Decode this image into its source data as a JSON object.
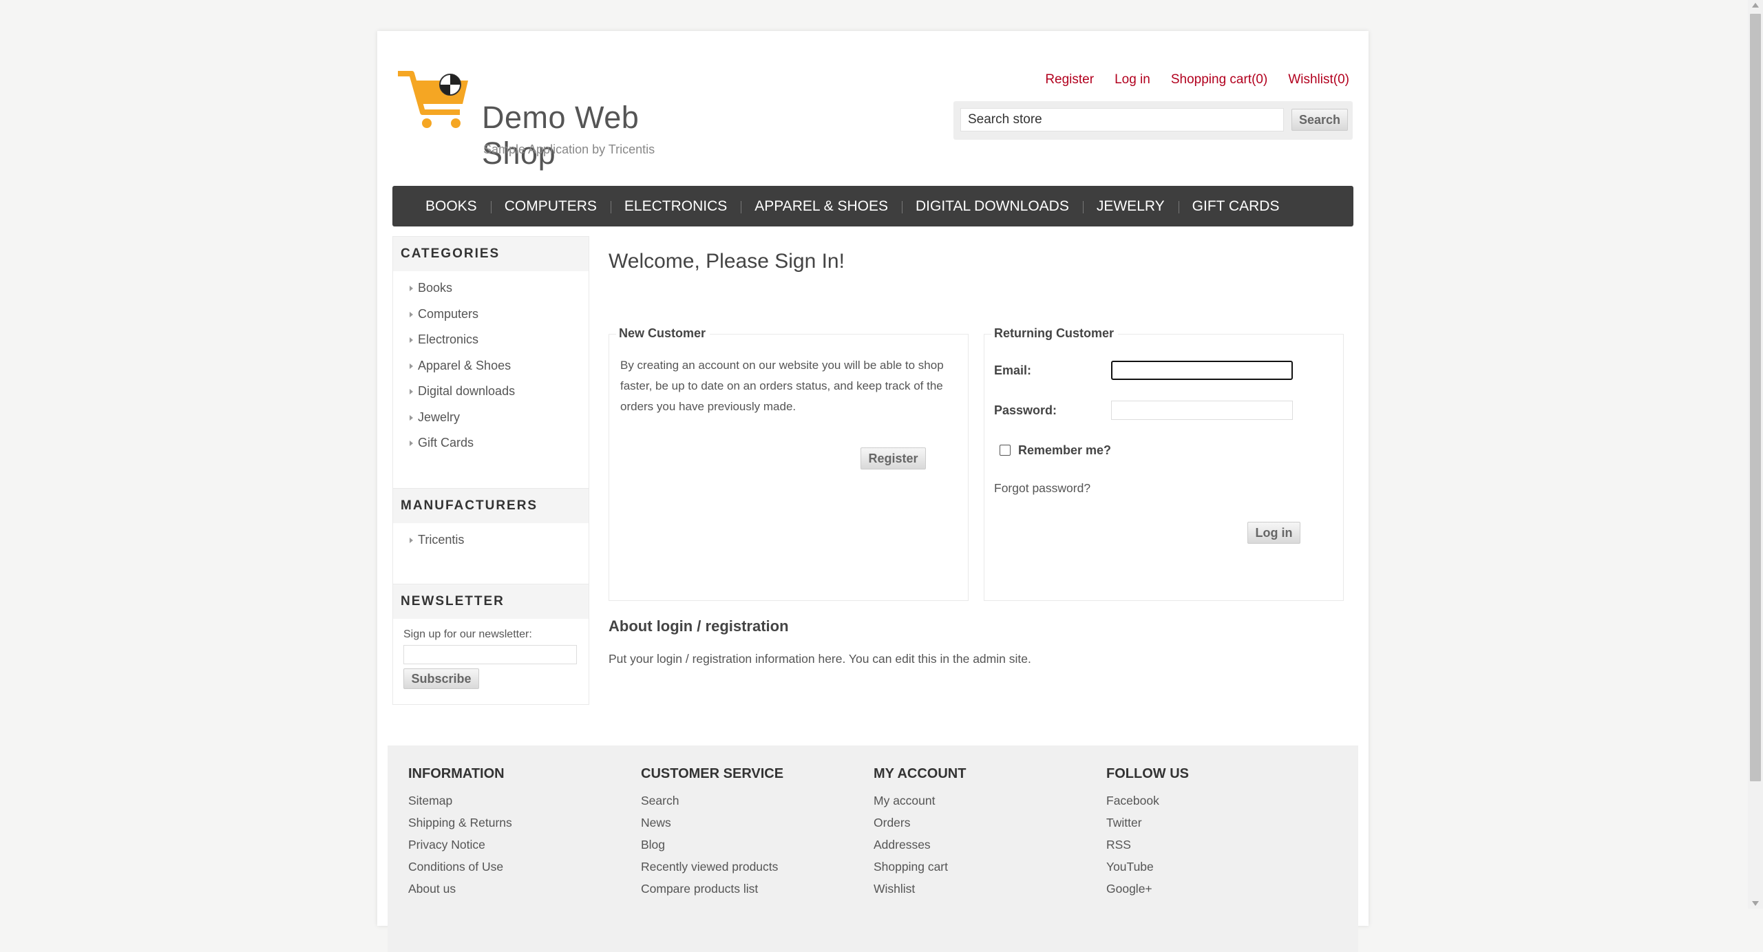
{
  "header": {
    "logo_title": "Demo Web Shop",
    "logo_subtitle": "Sample Application by Tricentis",
    "links": {
      "register": "Register",
      "login": "Log in",
      "cart": "Shopping cart(0)",
      "wishlist": "Wishlist(0)"
    },
    "search": {
      "value": "Search store",
      "button": "Search"
    }
  },
  "menu": [
    "BOOKS",
    "COMPUTERS",
    "ELECTRONICS",
    "APPAREL & SHOES",
    "DIGITAL DOWNLOADS",
    "JEWELRY",
    "GIFT CARDS"
  ],
  "sidebar": {
    "categories": {
      "title": "CATEGORIES",
      "items": [
        "Books",
        "Computers",
        "Electronics",
        "Apparel & Shoes",
        "Digital downloads",
        "Jewelry",
        "Gift Cards"
      ]
    },
    "manufacturers": {
      "title": "MANUFACTURERS",
      "items": [
        "Tricentis"
      ]
    },
    "newsletter": {
      "title": "NEWSLETTER",
      "label": "Sign up for our newsletter:",
      "button": "Subscribe"
    }
  },
  "main": {
    "title": "Welcome, Please Sign In!",
    "new_customer": {
      "legend": "New Customer",
      "text": "By creating an account on our website you will be able to shop faster, be up to date on an orders status, and keep track of the orders you have previously made.",
      "button": "Register"
    },
    "returning": {
      "legend": "Returning Customer",
      "email_label": "Email:",
      "password_label": "Password:",
      "remember_label": "Remember me?",
      "forgot": "Forgot password?",
      "button": "Log in"
    },
    "about_title": "About login / registration",
    "about_text": "Put your login / registration information here. You can edit this in the admin site."
  },
  "footer": {
    "columns": [
      {
        "title": "INFORMATION",
        "items": [
          "Sitemap",
          "Shipping & Returns",
          "Privacy Notice",
          "Conditions of Use",
          "About us"
        ]
      },
      {
        "title": "CUSTOMER SERVICE",
        "items": [
          "Search",
          "News",
          "Blog",
          "Recently viewed products",
          "Compare products list"
        ]
      },
      {
        "title": "MY ACCOUNT",
        "items": [
          "My account",
          "Orders",
          "Addresses",
          "Shopping cart",
          "Wishlist"
        ]
      },
      {
        "title": "FOLLOW US",
        "items": [
          "Facebook",
          "Twitter",
          "RSS",
          "YouTube",
          "Google+"
        ]
      }
    ]
  },
  "colors": {
    "link_red": "#b2001e",
    "menu_bg": "#3e3e3e",
    "logo_orange": "#f5a623"
  }
}
